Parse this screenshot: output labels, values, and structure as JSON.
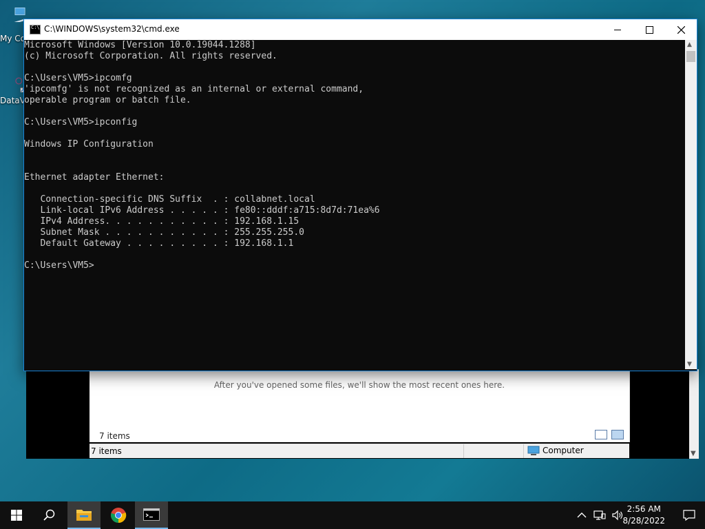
{
  "desktop": {
    "icons": [
      {
        "label": "My Co",
        "name": "my-computer-icon"
      },
      {
        "label": "DataV",
        "name": "data-icon"
      }
    ]
  },
  "explorer": {
    "recent_message": "After you've opened some files, we'll show the most recent ones here.",
    "items_inner": "7 items",
    "status_count": "7 items",
    "status_location": "Computer"
  },
  "cmd": {
    "title": "C:\\WINDOWS\\system32\\cmd.exe",
    "console_lines": [
      "Microsoft Windows [Version 10.0.19044.1288]",
      "(c) Microsoft Corporation. All rights reserved.",
      "",
      "C:\\Users\\VM5>ipcomfg",
      "'ipcomfg' is not recognized as an internal or external command,",
      "operable program or batch file.",
      "",
      "C:\\Users\\VM5>ipconfig",
      "",
      "Windows IP Configuration",
      "",
      "",
      "Ethernet adapter Ethernet:",
      "",
      "   Connection-specific DNS Suffix  . : collabnet.local",
      "   Link-local IPv6 Address . . . . . : fe80::dddf:a715:8d7d:71ea%6",
      "   IPv4 Address. . . . . . . . . . . : 192.168.1.15",
      "   Subnet Mask . . . . . . . . . . . : 255.255.255.0",
      "   Default Gateway . . . . . . . . . : 192.168.1.1",
      "",
      "C:\\Users\\VM5>"
    ]
  },
  "taskbar": {
    "clock_time": "2:56 AM",
    "clock_date": "8/28/2022"
  },
  "colors": {
    "console_bg": "#0c0c0c",
    "console_text": "#cccccc",
    "taskbar_bg": "#101010",
    "accent": "#1883d7"
  }
}
